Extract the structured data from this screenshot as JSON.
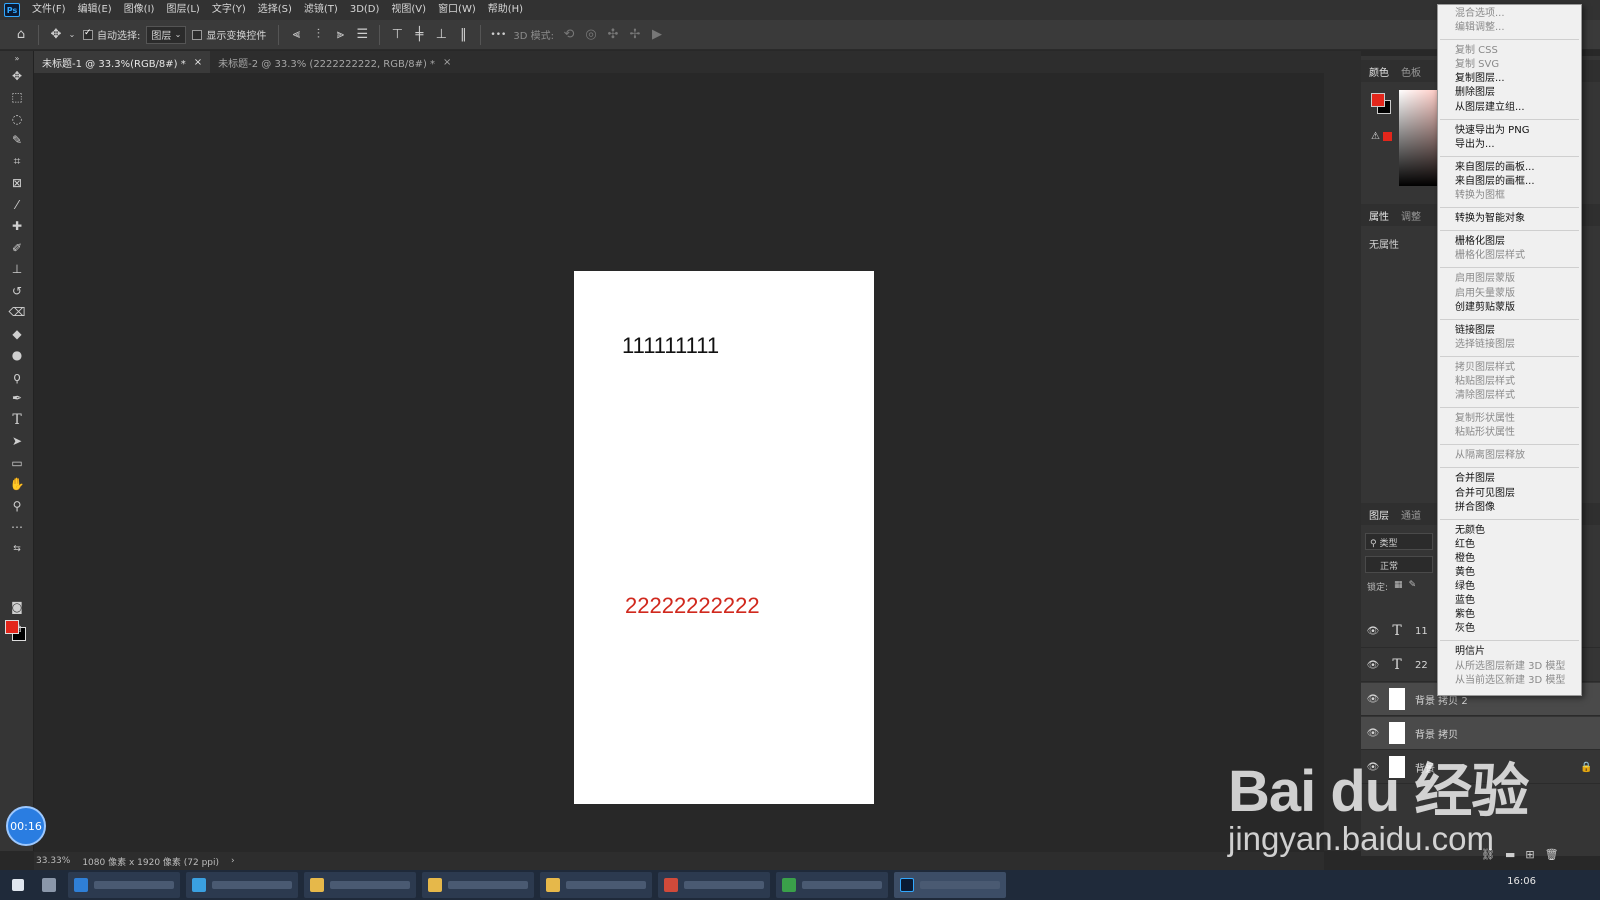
{
  "menubar": {
    "logo": "Ps",
    "items": [
      "文件(F)",
      "编辑(E)",
      "图像(I)",
      "图层(L)",
      "文字(Y)",
      "选择(S)",
      "滤镜(T)",
      "3D(D)",
      "视图(V)",
      "窗口(W)",
      "帮助(H)"
    ]
  },
  "options": {
    "auto_select_label": "自动选择:",
    "auto_select_checked": true,
    "layer_select_value": "图层",
    "show_transform_label": "显示变换控件",
    "show_transform_checked": false,
    "more_label": "•••",
    "mode_3d_label": "3D 模式:"
  },
  "tabs": [
    {
      "label": "未标题-1 @ 33.3%(RGB/8#) *",
      "close": "×",
      "active": true
    },
    {
      "label": "未标题-2 @ 33.3% (2222222222, RGB/8#) *",
      "close": "×",
      "active": false
    }
  ],
  "canvas": {
    "text1": "111111111",
    "text2": "22222222222"
  },
  "status": {
    "zoom": "33.33%",
    "doc_info": "1080 像素 x 1920 像素 (72 ppi)",
    "arrow": "›"
  },
  "timer": "00:16",
  "panels": {
    "color_tabs": [
      "颜色",
      "色板"
    ],
    "properties_tabs": [
      "属性",
      "调整"
    ],
    "no_properties": "无属性",
    "layers_tabs": [
      "图层",
      "通道"
    ],
    "search_placeholder": "类型",
    "blend_mode": "正常",
    "lock_label": "锁定:"
  },
  "layers": [
    {
      "name": "11",
      "type": "text",
      "eye": true
    },
    {
      "name": "22",
      "type": "text",
      "eye": true
    },
    {
      "name": "背景 拷贝 2",
      "type": "image",
      "eye": true,
      "selected": true
    },
    {
      "name": "背景 拷贝",
      "type": "image",
      "eye": true,
      "selected": true
    },
    {
      "name": "背景",
      "type": "image",
      "eye": true,
      "locked": true
    }
  ],
  "context_menu": {
    "groups": [
      [
        {
          "label": "混合选项...",
          "disabled": true
        },
        {
          "label": "编辑调整...",
          "disabled": true
        }
      ],
      [
        {
          "label": "复制 CSS",
          "disabled": true
        },
        {
          "label": "复制 SVG",
          "disabled": true
        },
        {
          "label": "复制图层...",
          "disabled": false
        },
        {
          "label": "删除图层",
          "disabled": false
        },
        {
          "label": "从图层建立组...",
          "disabled": false
        }
      ],
      [
        {
          "label": "快速导出为 PNG",
          "disabled": false
        },
        {
          "label": "导出为...",
          "disabled": false
        }
      ],
      [
        {
          "label": "来自图层的画板...",
          "disabled": false
        },
        {
          "label": "来自图层的画框...",
          "disabled": false
        },
        {
          "label": "转换为图框",
          "disabled": true
        }
      ],
      [
        {
          "label": "转换为智能对象",
          "disabled": false
        }
      ],
      [
        {
          "label": "栅格化图层",
          "disabled": false
        },
        {
          "label": "栅格化图层样式",
          "disabled": true
        }
      ],
      [
        {
          "label": "启用图层蒙版",
          "disabled": true
        },
        {
          "label": "启用矢量蒙版",
          "disabled": true
        },
        {
          "label": "创建剪贴蒙版",
          "disabled": false
        }
      ],
      [
        {
          "label": "链接图层",
          "disabled": false
        },
        {
          "label": "选择链接图层",
          "disabled": true
        }
      ],
      [
        {
          "label": "拷贝图层样式",
          "disabled": true
        },
        {
          "label": "粘贴图层样式",
          "disabled": true
        },
        {
          "label": "清除图层样式",
          "disabled": true
        }
      ],
      [
        {
          "label": "复制形状属性",
          "disabled": true
        },
        {
          "label": "粘贴形状属性",
          "disabled": true
        }
      ],
      [
        {
          "label": "从隔离图层释放",
          "disabled": true
        }
      ],
      [
        {
          "label": "合并图层",
          "disabled": false
        },
        {
          "label": "合并可见图层",
          "disabled": false
        },
        {
          "label": "拼合图像",
          "disabled": false
        }
      ],
      [
        {
          "label": "无颜色",
          "disabled": false
        },
        {
          "label": "红色",
          "disabled": false
        },
        {
          "label": "橙色",
          "disabled": false
        },
        {
          "label": "黄色",
          "disabled": false
        },
        {
          "label": "绿色",
          "disabled": false
        },
        {
          "label": "蓝色",
          "disabled": false
        },
        {
          "label": "紫色",
          "disabled": false
        },
        {
          "label": "灰色",
          "disabled": false
        }
      ],
      [
        {
          "label": "明信片",
          "disabled": false
        },
        {
          "label": "从所选图层新建 3D 模型",
          "disabled": true
        },
        {
          "label": "从当前选区新建 3D 模型",
          "disabled": true
        }
      ]
    ]
  },
  "watermark": {
    "brand": "Bai du 经验",
    "url": "jingyan.baidu.com"
  },
  "taskbar": {
    "clock": "16:06"
  },
  "colors": {
    "foreground": "#e3261b",
    "background": "#000000",
    "text2": "#d0281d"
  }
}
